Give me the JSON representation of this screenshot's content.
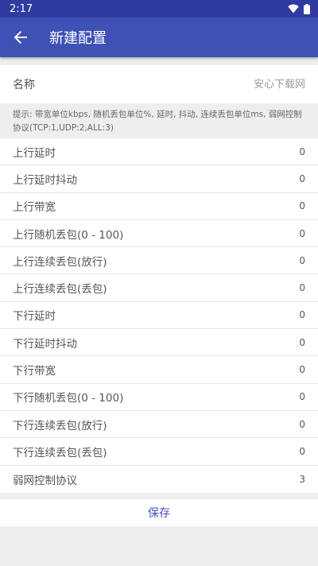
{
  "status_bar": {
    "time": "2:17"
  },
  "app_bar": {
    "title": "新建配置"
  },
  "name_field": {
    "label": "名称",
    "placeholder": "安心下载网"
  },
  "hint": "提示: 带宽单位kbps, 随机丢包单位%, 延时, 抖动, 连续丢包单位ms, 弱网控制协议(TCP:1,UDP:2,ALL:3)",
  "rows": [
    {
      "label": "上行延时",
      "value": "0"
    },
    {
      "label": "上行延时抖动",
      "value": "0"
    },
    {
      "label": "上行带宽",
      "value": "0"
    },
    {
      "label": "上行随机丢包(0 - 100)",
      "value": "0"
    },
    {
      "label": "上行连续丢包(放行)",
      "value": "0"
    },
    {
      "label": "上行连续丢包(丢包)",
      "value": "0"
    },
    {
      "label": "下行延时",
      "value": "0"
    },
    {
      "label": "下行延时抖动",
      "value": "0"
    },
    {
      "label": "下行带宽",
      "value": "0"
    },
    {
      "label": "下行随机丢包(0 - 100)",
      "value": "0"
    },
    {
      "label": "下行连续丢包(放行)",
      "value": "0"
    },
    {
      "label": "下行连续丢包(丢包)",
      "value": "0"
    },
    {
      "label": "弱网控制协议",
      "value": "3"
    }
  ],
  "save_label": "保存",
  "colors": {
    "status_bar": "#2f3ba0",
    "app_bar": "#3f51b5",
    "accent": "#3f51b5",
    "background": "#eeeeee"
  },
  "icons": {
    "back": "arrow-left-icon",
    "wifi": "wifi-icon",
    "battery": "battery-icon"
  }
}
